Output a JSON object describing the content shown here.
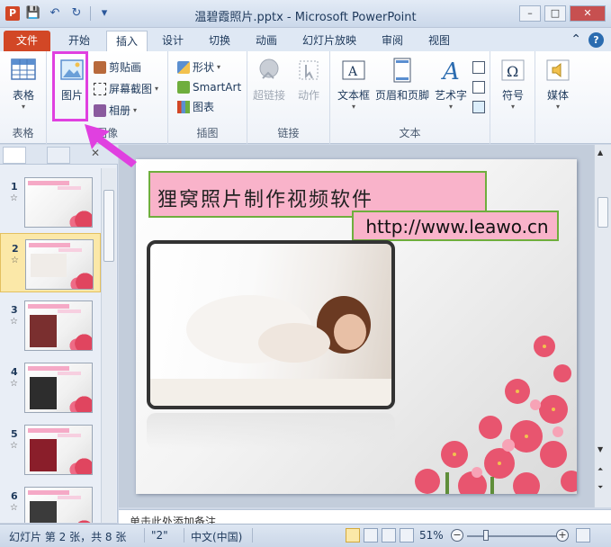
{
  "window": {
    "title": "温碧霞照片.pptx - Microsoft PowerPoint",
    "app_icon_letter": "P"
  },
  "tabs": [
    {
      "label": "文件"
    },
    {
      "label": "开始"
    },
    {
      "label": "插入"
    },
    {
      "label": "设计"
    },
    {
      "label": "切换"
    },
    {
      "label": "动画"
    },
    {
      "label": "幻灯片放映"
    },
    {
      "label": "审阅"
    },
    {
      "label": "视图"
    }
  ],
  "ribbon": {
    "groups": {
      "tables": {
        "label": "表格",
        "table_btn": "表格"
      },
      "images": {
        "label": "图像",
        "picture_btn": "图片",
        "clipart_btn": "剪贴画",
        "screenshot_btn": "屏幕截图",
        "album_btn": "相册"
      },
      "illustrations": {
        "label": "插图",
        "shapes_btn": "形状",
        "smartart_btn": "SmartArt",
        "chart_btn": "图表"
      },
      "links": {
        "label": "链接",
        "hyperlink_btn": "超链接",
        "action_btn": "动作"
      },
      "text": {
        "label": "文本",
        "textbox_btn": "文本框",
        "headerfooter_btn": "页眉和页脚",
        "wordart_btn": "艺术字"
      },
      "symbols": {
        "symbol_btn": "符号"
      },
      "media": {
        "media_btn": "媒体"
      }
    }
  },
  "slides_panel": {
    "slides": [
      {
        "num": "1",
        "star": "☆"
      },
      {
        "num": "2",
        "star": "☆"
      },
      {
        "num": "3",
        "star": "☆"
      },
      {
        "num": "4",
        "star": "☆"
      },
      {
        "num": "5",
        "star": "☆"
      },
      {
        "num": "6",
        "star": "☆"
      }
    ]
  },
  "slide": {
    "title": "狸窝照片制作视频软件",
    "url": "http://www.leawo.cn"
  },
  "notes_placeholder": "单击此处添加备注",
  "status": {
    "slide_info": "幻灯片 第 2 张，共 8 张",
    "theme": "\"2\"",
    "language": "中文(中国)",
    "zoom": "51%"
  },
  "colors": {
    "file_tab": "#d24726",
    "highlight": "#e040e0",
    "title_box": "#f9b3ca",
    "title_border": "#6fae3d"
  }
}
